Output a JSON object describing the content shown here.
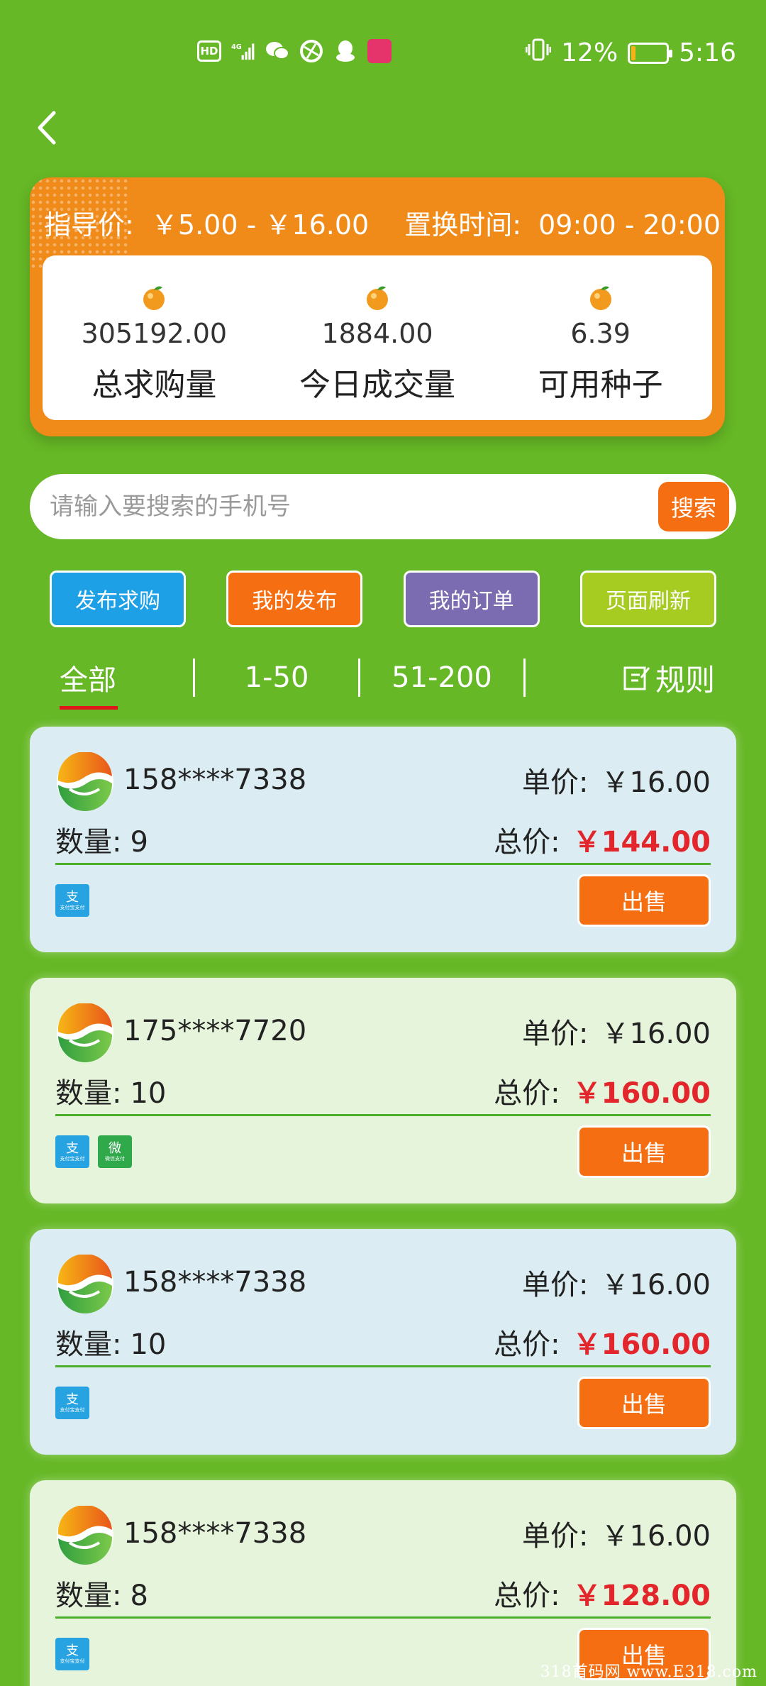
{
  "status_bar": {
    "left_icons": [
      "hd-icon",
      "4g-signal-icon",
      "wechat-icon",
      "browser-icon",
      "qq-icon",
      "app-icon"
    ],
    "hd_label": "HD",
    "net_label": "4G",
    "app_label": "",
    "battery_percent": "12%",
    "battery_level": 0.12,
    "time": "5:16"
  },
  "summary": {
    "guide_price_label": "指导价:",
    "guide_price_value": "￥5.00 - ￥16.00",
    "swap_time_label": "置换时间:",
    "swap_time_value": "09:00 - 20:00",
    "stats": [
      {
        "value": "305192.00",
        "label": "总求购量"
      },
      {
        "value": "1884.00",
        "label": "今日成交量"
      },
      {
        "value": "6.39",
        "label": "可用种子"
      }
    ]
  },
  "search": {
    "placeholder": "请输入要搜索的手机号",
    "button": "搜索"
  },
  "actions": [
    {
      "label": "发布求购",
      "color": "#1ea0e6"
    },
    {
      "label": "我的发布",
      "color": "#f56f12"
    },
    {
      "label": "我的订单",
      "color": "#7b6bb0"
    },
    {
      "label": "页面刷新",
      "color": "#a6cb21"
    }
  ],
  "tabs": {
    "all": "全部",
    "range1": "1-50",
    "range2": "51-200",
    "rules": "规则"
  },
  "orders": [
    {
      "phone": "158****7338",
      "price_label": "单价:",
      "price": "￥16.00",
      "qty_label": "数量:",
      "qty": "9",
      "total_label": "总价:",
      "total": "￥144.00",
      "pay": [
        "alipay"
      ],
      "theme": "blue"
    },
    {
      "phone": "175****7720",
      "price_label": "单价:",
      "price": "￥16.00",
      "qty_label": "数量:",
      "qty": "10",
      "total_label": "总价:",
      "total": "￥160.00",
      "pay": [
        "alipay",
        "wechat"
      ],
      "theme": "green"
    },
    {
      "phone": "158****7338",
      "price_label": "单价:",
      "price": "￥16.00",
      "qty_label": "数量:",
      "qty": "10",
      "total_label": "总价:",
      "total": "￥160.00",
      "pay": [
        "alipay"
      ],
      "theme": "blue"
    },
    {
      "phone": "158****7338",
      "price_label": "单价:",
      "price": "￥16.00",
      "qty_label": "数量:",
      "qty": "8",
      "total_label": "总价:",
      "total": "￥128.00",
      "pay": [
        "alipay"
      ],
      "theme": "green"
    }
  ],
  "sell_label": "出售",
  "pay_labels": {
    "alipay_glyph": "支",
    "alipay_text": "支付宝支付",
    "wechat_glyph": "微",
    "wechat_text": "微信支付"
  },
  "watermark": "318首码网 www.E318.com"
}
